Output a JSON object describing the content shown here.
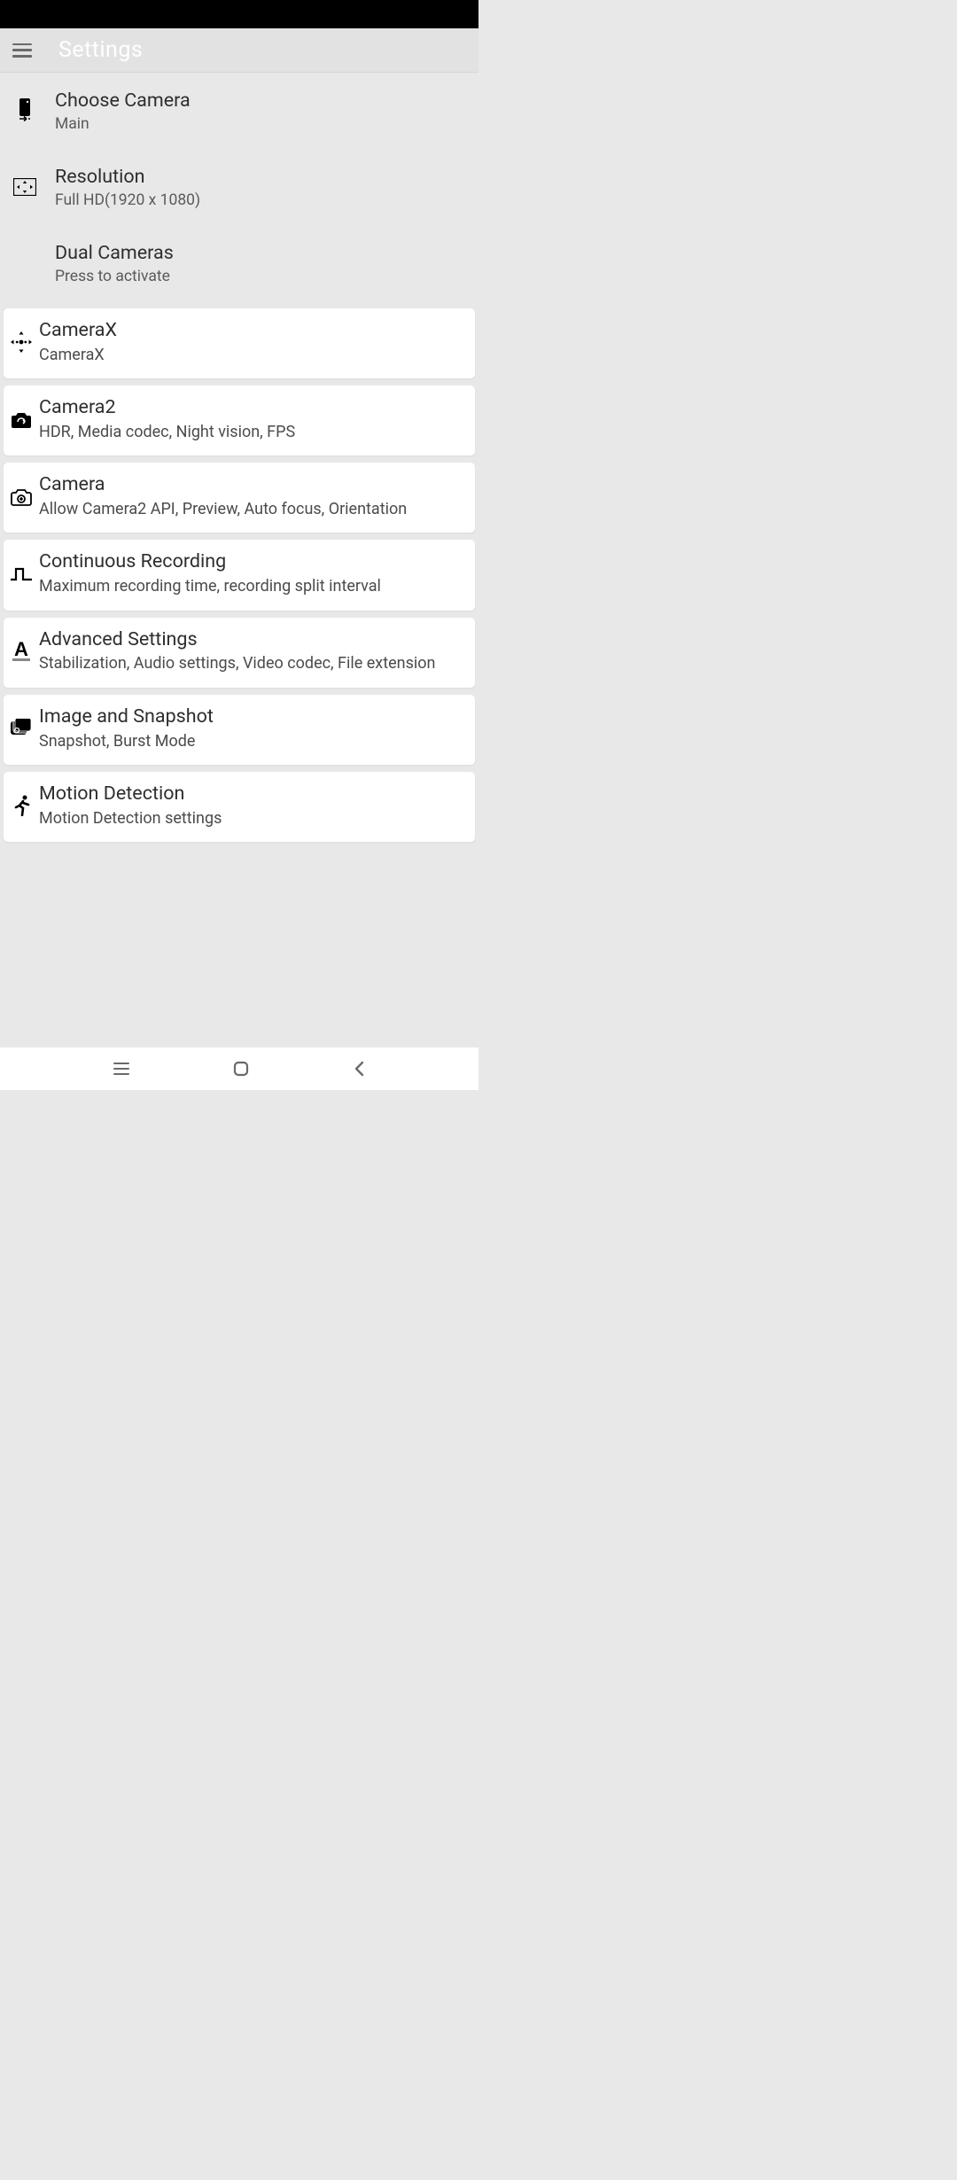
{
  "header": {
    "title": "Settings"
  },
  "top_rows": [
    {
      "id": "choose-camera",
      "icon": "switch-camera",
      "title": "Choose Camera",
      "subtitle": "Main"
    },
    {
      "id": "resolution",
      "icon": "resolution",
      "title": "Resolution",
      "subtitle": "Full HD(1920 x 1080)"
    },
    {
      "id": "dual-cameras",
      "icon": "",
      "title": "Dual Cameras",
      "subtitle": "Press to activate"
    }
  ],
  "cards": [
    {
      "id": "camerax",
      "icon": "move-dots",
      "title": "CameraX",
      "subtitle": "CameraX"
    },
    {
      "id": "camera2",
      "icon": "camera-switch",
      "title": "Camera2",
      "subtitle": "HDR, Media codec, Night vision, FPS"
    },
    {
      "id": "camera",
      "icon": "camera-plus",
      "title": "Camera",
      "subtitle": "Allow Camera2 API, Preview, Auto focus, Orientation"
    },
    {
      "id": "continuous-recording",
      "icon": "pulse",
      "title": "Continuous Recording",
      "subtitle": "Maximum recording time, recording split interval"
    },
    {
      "id": "advanced",
      "icon": "letter-a",
      "title": "Advanced Settings",
      "subtitle": "Stabilization, Audio settings, Video codec, File extension"
    },
    {
      "id": "image-snapshot",
      "icon": "burst",
      "title": "Image and Snapshot",
      "subtitle": "Snapshot, Burst Mode"
    },
    {
      "id": "motion-detection",
      "icon": "runner",
      "title": "Motion Detection",
      "subtitle": "Motion Detection settings"
    }
  ]
}
